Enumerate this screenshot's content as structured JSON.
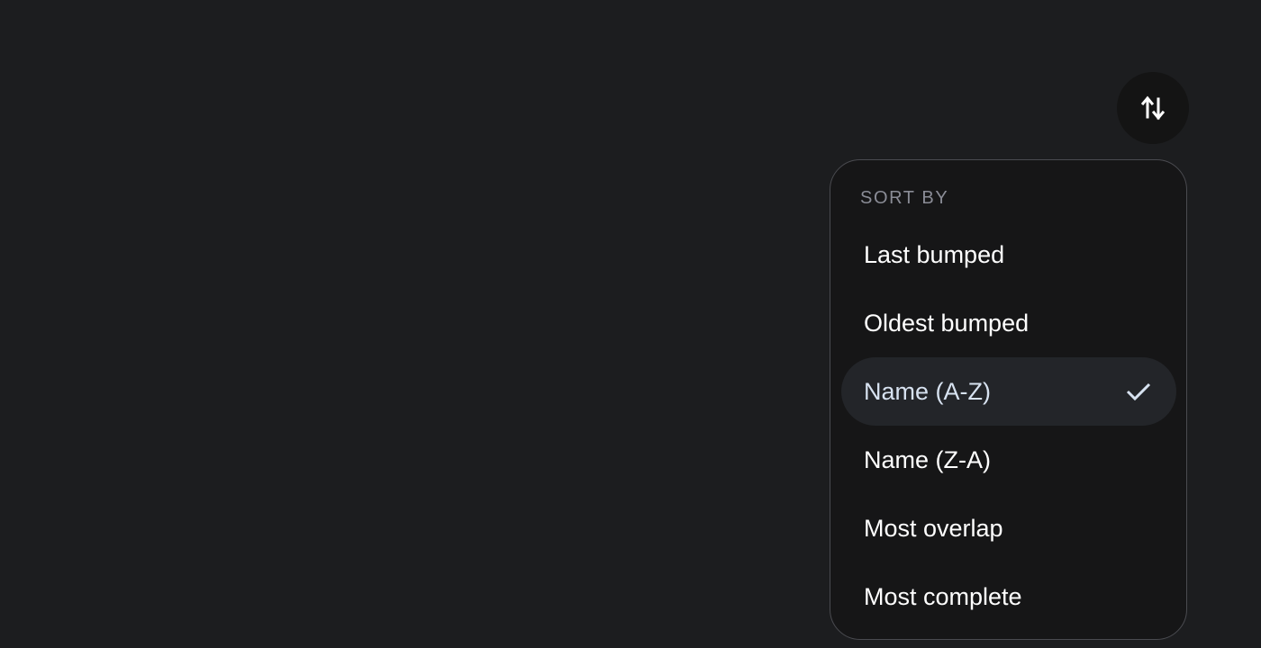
{
  "sort_button": {
    "icon": "swap-vertical-icon"
  },
  "menu": {
    "header": "SORT BY",
    "items": [
      {
        "label": "Last bumped",
        "selected": false
      },
      {
        "label": "Oldest bumped",
        "selected": false
      },
      {
        "label": "Name (A-Z)",
        "selected": true
      },
      {
        "label": "Name (Z-A)",
        "selected": false
      },
      {
        "label": "Most overlap",
        "selected": false
      },
      {
        "label": "Most complete",
        "selected": false
      }
    ],
    "check_icon": "checkmark-icon"
  },
  "colors": {
    "background": "#1c1d1f",
    "menu_background": "#161617",
    "selected_background": "#232529",
    "selected_text": "#d7e2f0",
    "header_text": "#8a8c96"
  }
}
